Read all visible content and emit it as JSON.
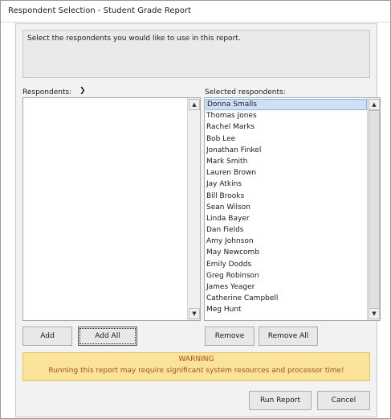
{
  "window": {
    "title": "Respondent Selection - Student Grade Report"
  },
  "instructions": "Select the respondents you would like to use in this report.",
  "left_list": {
    "label": "Respondents:",
    "items": []
  },
  "right_list": {
    "label": "Selected respondents:",
    "items": [
      "Donna Smalls",
      "Thomas Jones",
      "Rachel Marks",
      "Bob Lee",
      "Jonathan Finkel",
      "Mark Smith",
      "Lauren Brown",
      "Jay Atkins",
      "Bill Brooks",
      "Sean Wilson",
      "Linda Bayer",
      "Dan Fields",
      "Amy Johnson",
      "May Newcomb",
      "Emily Dodds",
      "Greg Robinson",
      "James Yeager",
      "Catherine Campbell",
      "Meg Hunt"
    ],
    "selected_index": 0
  },
  "buttons": {
    "add": "Add",
    "add_all": "Add All",
    "remove": "Remove",
    "remove_all": "Remove All",
    "run_report": "Run Report",
    "cancel": "Cancel"
  },
  "warning": {
    "heading": "WARNING",
    "message": "Running this report may require significant system resources and processor time!"
  },
  "colors": {
    "selection": "#cde0f7",
    "warning_bg": "#fbe39a",
    "warning_text": "#b44a1a"
  },
  "icons": {
    "dropdown": "chevron-down-icon",
    "scroll_up": "arrow-up-icon",
    "scroll_down": "arrow-down-icon"
  }
}
